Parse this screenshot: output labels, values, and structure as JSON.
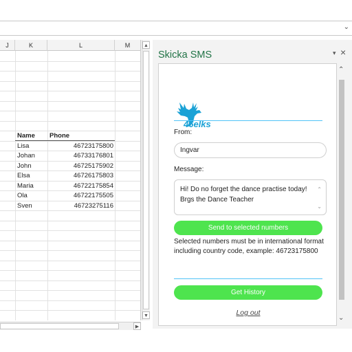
{
  "columns": [
    "J",
    "K",
    "L",
    "M"
  ],
  "table": {
    "headers": [
      "Name",
      "Phone"
    ],
    "rows": [
      {
        "name": "Lisa",
        "phone": "46723175800"
      },
      {
        "name": "Johan",
        "phone": "46733176801"
      },
      {
        "name": "John",
        "phone": "46725175902"
      },
      {
        "name": "Elsa",
        "phone": "46726175803"
      },
      {
        "name": "Maria",
        "phone": "46722175854"
      },
      {
        "name": "Ola",
        "phone": "46722175505"
      },
      {
        "name": "Sven",
        "phone": "46723275116"
      }
    ]
  },
  "pane": {
    "title": "Skicka SMS",
    "logo_text": "46elks",
    "from_label": "From:",
    "from_value": "Ingvar",
    "message_label": "Message:",
    "message_line1": "Hi! Do no forget the dance practise today!",
    "message_line2": "Brgs the Dance Teacher",
    "send_button": "Send to selected numbers",
    "info": "Selected numbers must be in international format including country code, example: 46723175800",
    "history_button": "Get History",
    "logout": "Log out"
  },
  "colors": {
    "title_green": "#217346",
    "button_green": "#4ee44e",
    "divider_blue": "#4fc3f7",
    "logo_blue": "#1ba2d6"
  }
}
